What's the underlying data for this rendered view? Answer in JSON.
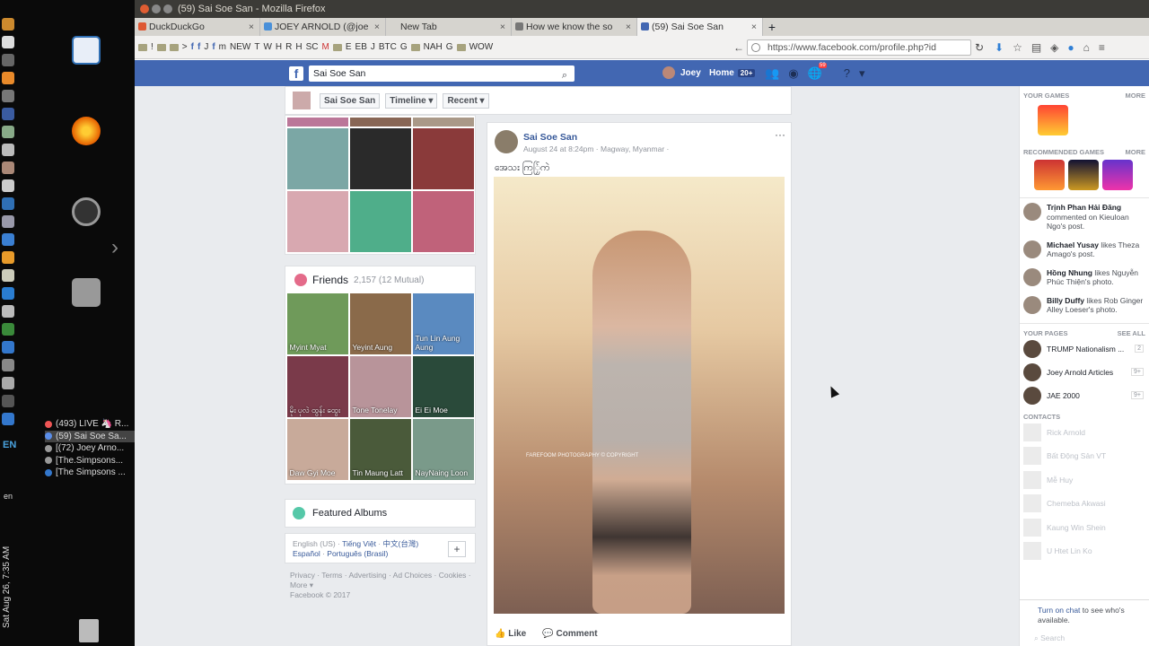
{
  "os": {
    "clock": "Sat Aug 26, 7:35 AM",
    "lang_indicator": "EN",
    "lang_small": "en",
    "taskbar_items": [
      "(493) LIVE 🦄 R...",
      "(59) Sai Soe Sa...",
      "[(72) Joey Arno...",
      "[The.Simpsons...",
      "[The Simpsons ..."
    ]
  },
  "browser": {
    "window_title": "(59) Sai Soe San - Mozilla Firefox",
    "tabs": [
      {
        "label": "DuckDuckGo"
      },
      {
        "label": "JOEY ARNOLD (@joe"
      },
      {
        "label": "New Tab"
      },
      {
        "label": "How we know the so"
      },
      {
        "label": "(59) Sai Soe San"
      }
    ],
    "bookmarks": [
      "!",
      ">",
      "J",
      "m",
      "NEW",
      "T",
      "W",
      "H",
      "R",
      "H",
      "SC",
      "M",
      "E",
      "EB",
      "J",
      "BTC",
      "G",
      "NAH",
      "G",
      "WOW"
    ],
    "url": "https://www.facebook.com/profile.php?id"
  },
  "fb": {
    "logo": "f",
    "search_value": "Sai Soe San",
    "user_name": "Joey",
    "home_label": "Home",
    "home_badge": "20+",
    "notif_count": "59",
    "subnav": {
      "name": "Sai Soe San",
      "timeline": "Timeline ▾",
      "recent": "Recent ▾"
    },
    "friends": {
      "title": "Friends",
      "count": "2,157 (12 Mutual)",
      "items": [
        "Myint Myat",
        "Yeyint Aung",
        "Tun Lin Aung Aung",
        "မိုး ပုလဲ ထွန်း ထွေး",
        "Tone Tonelay",
        "Ei Ei Moe",
        "Daw Gyi Moe",
        "Tin Maung Latt",
        "NayNaing Loon"
      ]
    },
    "albums_label": "Featured Albums",
    "languages": {
      "current": "English (US)",
      "others": [
        "Tiếng Việt",
        "中文(台灣)",
        "Español",
        "Português (Brasil)"
      ],
      "plus": "+"
    },
    "footer_links": [
      "Privacy",
      "Terms",
      "Advertising",
      "Ad Choices",
      "Cookies",
      "More ▾"
    ],
    "copyright": "Facebook © 2017",
    "post": {
      "author": "Sai Soe San",
      "meta": "August 24 at 8:24pm · Magway, Myanmar ·",
      "text": "အေသး ကြြှ်ကဲ",
      "watermark": "FAREFOOM PHOTOGRAPHY © COPYRIGHT",
      "like": "Like",
      "comment": "Comment",
      "more": "···"
    },
    "right": {
      "your_games": "YOUR GAMES",
      "more": "MORE",
      "recommended_games": "RECOMMENDED GAMES",
      "ticker": [
        {
          "name": "Trịnh Phan Hải Đăng",
          "text": "commented on Kieuloan Ngo's post."
        },
        {
          "name": "Michael Yusay",
          "text": "likes Theza Amago's post."
        },
        {
          "name": "Hồng Nhung",
          "text": "likes Nguyễn Phúc Thiện's photo."
        },
        {
          "name": "Billy Duffy",
          "text": "likes Rob Ginger Alley Loeser's photo."
        }
      ],
      "your_pages": "YOUR PAGES",
      "see_all": "SEE ALL",
      "pages": [
        {
          "name": "TRUMP Nationalism ...",
          "badge": "2"
        },
        {
          "name": "Joey Arnold Articles",
          "badge": "9+"
        },
        {
          "name": "JAE 2000",
          "badge": "9+"
        }
      ],
      "contacts_title": "CONTACTS",
      "contacts": [
        "Rick Arnold",
        "Bất Động Sản VT",
        "Mễ Huy",
        "Chemeba Akwasi",
        "Kaung Win Shein",
        "U Htet Lin Ko"
      ],
      "chat_link": "Turn on chat",
      "chat_text": " to see who's available.",
      "search": "Search"
    }
  }
}
